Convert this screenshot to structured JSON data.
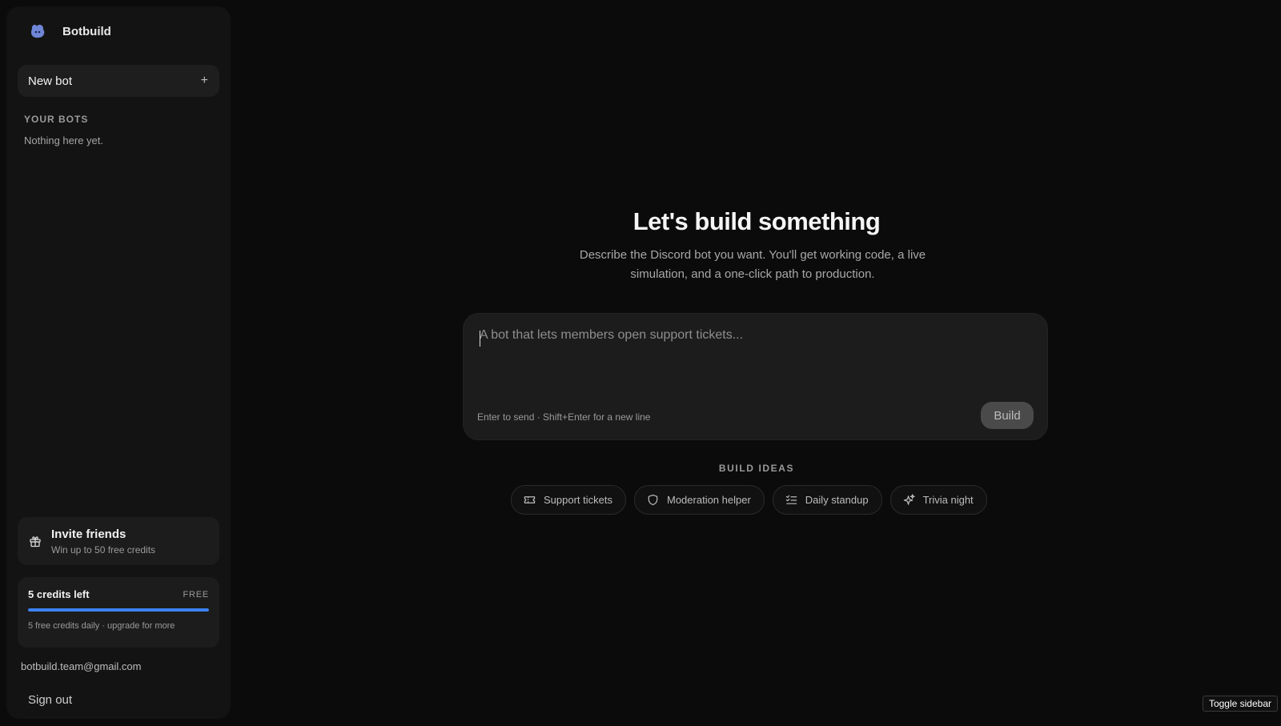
{
  "brand": {
    "name": "Botbuild",
    "logo_icon": "blob-logo-icon"
  },
  "sidebar": {
    "new_bot_label": "New bot",
    "new_bot_icon": "plus-icon",
    "section_label": "YOUR BOTS",
    "empty_text": "Nothing here yet.",
    "invite": {
      "title": "Invite friends",
      "subtitle": "Win up to 50 free credits",
      "icon": "gift-icon"
    },
    "credits": {
      "count_label": "5 credits left",
      "plan": "FREE",
      "remaining_fraction": 1.0,
      "note": "5 free credits daily · upgrade for more",
      "bar_color": "#3b82f6"
    },
    "email": "botbuild.team@gmail.com",
    "sign_out_label": "Sign out"
  },
  "main": {
    "title": "Let's build something",
    "subtitle": "Describe the Discord bot you want. You'll get working code, a live simulation, and a one-click path to production.",
    "composer": {
      "placeholder": "A bot that lets members open support tickets...",
      "value": "",
      "hint": "Enter to send · Shift+Enter for a new line",
      "build_label": "Build"
    },
    "ideas_label": "BUILD IDEAS",
    "ideas": [
      {
        "label": "Support tickets",
        "icon": "ticket-icon"
      },
      {
        "label": "Moderation helper",
        "icon": "shield-icon"
      },
      {
        "label": "Daily standup",
        "icon": "checklist-icon"
      },
      {
        "label": "Trivia night",
        "icon": "sparkles-icon"
      }
    ]
  },
  "tooltip": {
    "text": "Toggle sidebar"
  }
}
